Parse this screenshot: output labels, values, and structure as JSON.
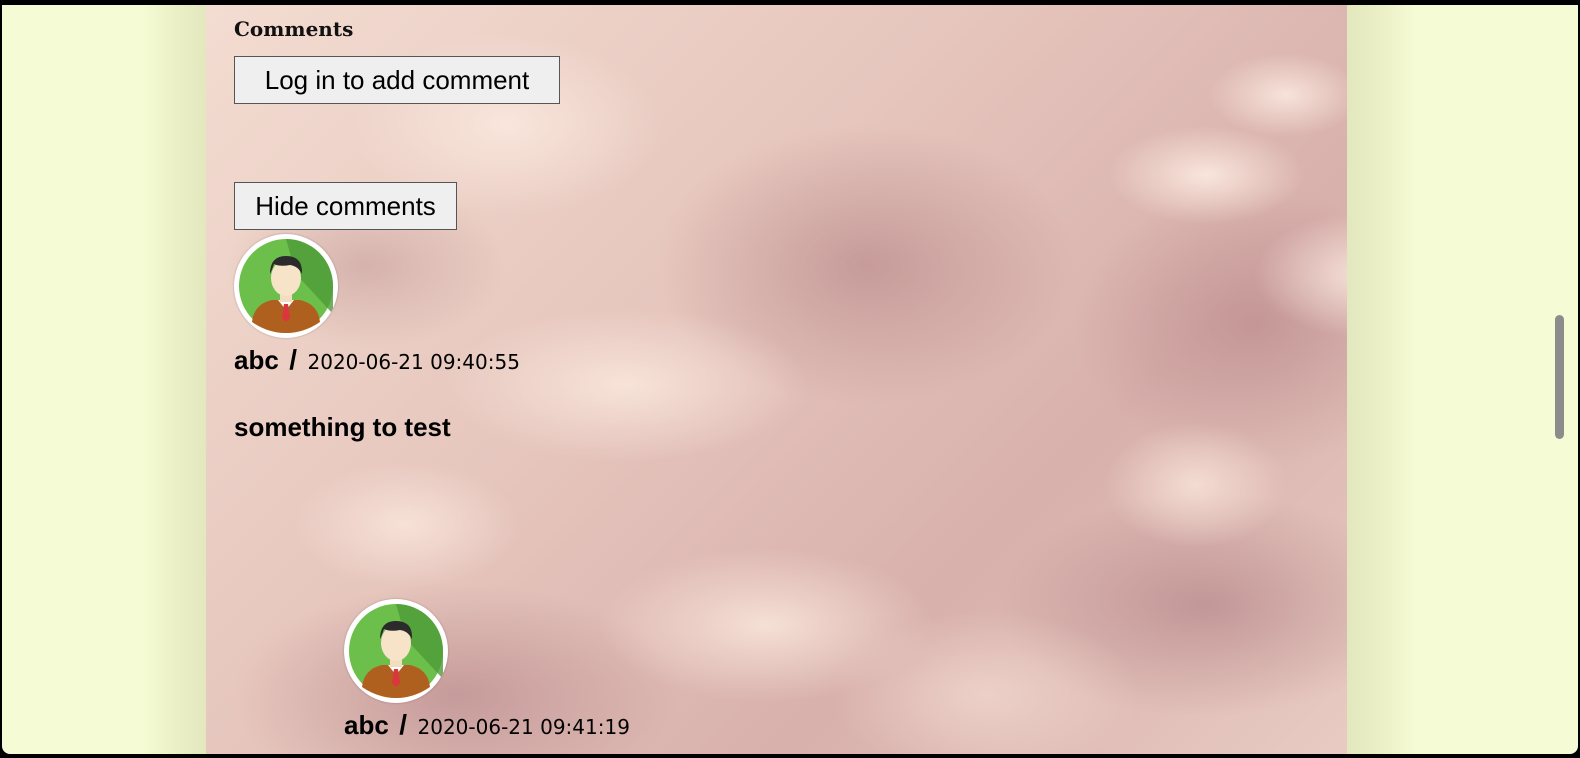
{
  "comments_section": {
    "heading": "Comments",
    "login_button_label": "Log in to add comment",
    "toggle_button_label": "Hide comments"
  },
  "comments": [
    {
      "avatar_icon": "user-avatar-icon",
      "author": "abc",
      "separator": "/",
      "timestamp": "2020-06-21 09:40:55",
      "body": "something to test"
    },
    {
      "avatar_icon": "user-avatar-icon",
      "author": "abc",
      "separator": "/",
      "timestamp": "2020-06-21 09:41:19"
    }
  ],
  "colors": {
    "page_background": "#f5fbd4",
    "button_background": "#efefef",
    "avatar_green": "#6bbf4a",
    "avatar_jacket": "#b0601e",
    "avatar_tie": "#d9363e"
  }
}
